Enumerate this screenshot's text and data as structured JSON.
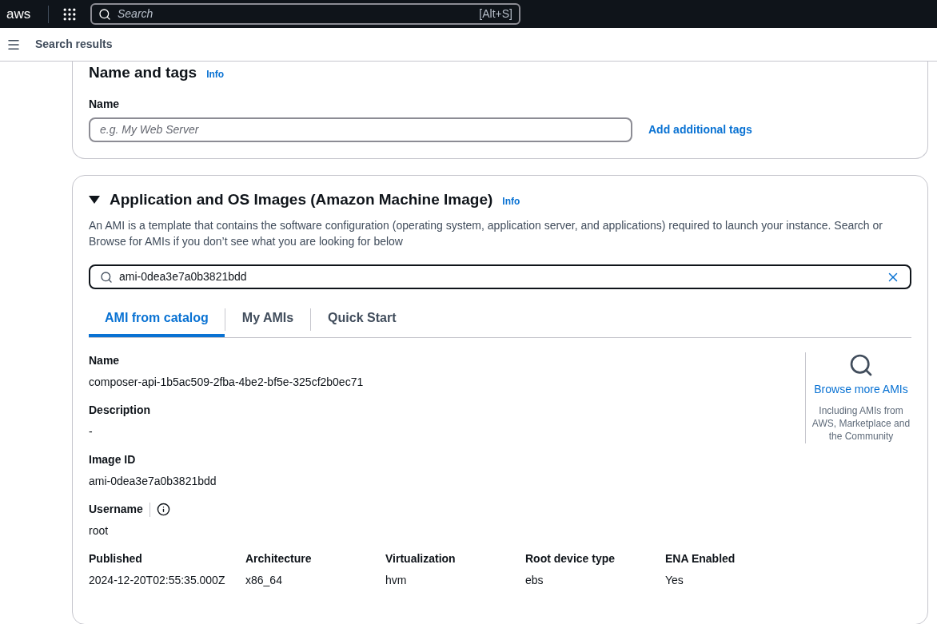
{
  "top_bar": {
    "logo": "aws",
    "search": {
      "placeholder": "Search",
      "shortcut": "[Alt+S]"
    }
  },
  "breadcrumb_bar": {
    "title": "Search results"
  },
  "name_and_tags": {
    "title": "Name and tags",
    "info": "Info",
    "name_label": "Name",
    "name_field": {
      "placeholder": "e.g. My Web Server"
    },
    "add_tags_link": "Add additional tags"
  },
  "ami_section": {
    "title": "Application and OS Images (Amazon Machine Image)",
    "expanded": true,
    "info": "Info",
    "description": "An AMI is a template that contains the software configuration (operating system, application server, and applications) required to launch your instance. Search or Browse for AMIs if you don’t see what you are looking for below",
    "search_value": "ami-0dea3e7a0b3821bdd",
    "tabs": [
      {
        "label": "AMI from catalog",
        "selected": true
      },
      {
        "label": "My AMIs",
        "selected": false
      },
      {
        "label": "Quick Start",
        "selected": false
      }
    ],
    "details": [
      {
        "label": "Name",
        "value": "composer-api-1b5ac509-2fba-4be2-bf5e-325cf2b0ec71",
        "info_icon": false
      },
      {
        "label": "Description",
        "value": "-",
        "info_icon": false
      },
      {
        "label": "Image ID",
        "value": "ami-0dea3e7a0b3821bdd",
        "info_icon": false
      },
      {
        "label": "Username",
        "value": "root",
        "info_icon": true
      }
    ],
    "attributes": [
      {
        "label": "Published",
        "value": "2024-12-20T02:55:35.000Z"
      },
      {
        "label": "Architecture",
        "value": "x86_64"
      },
      {
        "label": "Virtualization",
        "value": "hvm"
      },
      {
        "label": "Root device type",
        "value": "ebs"
      },
      {
        "label": "ENA Enabled",
        "value": "Yes"
      }
    ],
    "browse": {
      "link": "Browse more AMIs",
      "note": "Including AMIs from AWS, Marketplace and the Community"
    }
  }
}
